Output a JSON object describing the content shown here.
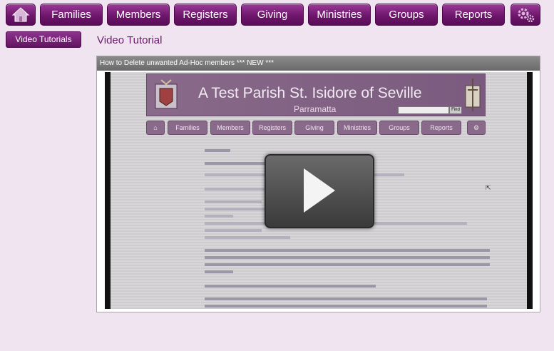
{
  "nav": {
    "items": [
      {
        "key": "home",
        "icon": "home-icon",
        "label": ""
      },
      {
        "key": "families",
        "label": "Families"
      },
      {
        "key": "members",
        "label": "Members"
      },
      {
        "key": "registers",
        "label": "Registers"
      },
      {
        "key": "giving",
        "label": "Giving"
      },
      {
        "key": "ministries",
        "label": "Ministries"
      },
      {
        "key": "groups",
        "label": "Groups"
      },
      {
        "key": "reports",
        "label": "Reports"
      },
      {
        "key": "settings",
        "icon": "gear-icon",
        "label": ""
      }
    ]
  },
  "sidebar": {
    "video_tutorials_label": "Video Tutorials"
  },
  "page": {
    "title": "Video Tutorial"
  },
  "panel": {
    "header": "How to Delete unwanted Ad-Hoc members *** NEW ***"
  },
  "video": {
    "banner_title": "A Test Parish St. Isidore of Seville",
    "banner_subtitle": "Parramatta",
    "search_button": "Find",
    "nav": [
      "Families",
      "Members",
      "Registers",
      "Giving",
      "Ministries",
      "Groups",
      "Reports"
    ],
    "play_icon": "play-icon"
  },
  "colors": {
    "accent": "#6e166c",
    "background": "#f0e4f0",
    "title": "#6a1a6a"
  }
}
